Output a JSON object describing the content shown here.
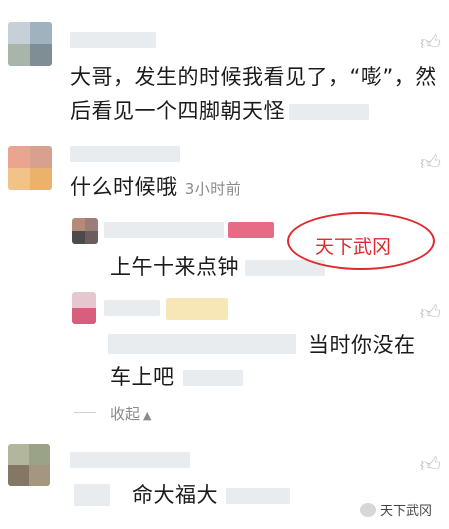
{
  "comments": [
    {
      "text_line1": "大哥，发生的时候我看见了，“嘭”，然",
      "text_line2": "后看见一个四脚朝天怪"
    },
    {
      "text": "什么时候哦",
      "time": "3小时前",
      "replies": [
        {
          "text": "上午十来点钟"
        },
        {
          "text_line1": "当时你没在",
          "text_line2": "车上吧"
        }
      ],
      "collapse_label": "收起"
    },
    {
      "text": "命大福大"
    }
  ],
  "icons": {
    "like": "thumbs-up-icon",
    "collapse": "triangle-up-icon",
    "watermark": "wechat-icon"
  },
  "watermark": {
    "circle_text": "天下武冈",
    "corner_text": "天下武冈"
  },
  "colors": {
    "watermark": "#e0282e",
    "meta": "#8a8a8a",
    "blur": "#d9dde0"
  }
}
